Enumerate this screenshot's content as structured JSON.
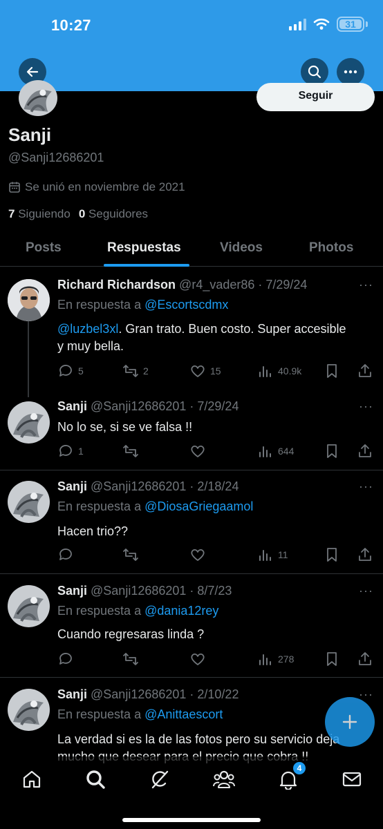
{
  "status_bar": {
    "time": "10:27",
    "battery": "31"
  },
  "profile": {
    "name": "Sanji",
    "handle": "@Sanji12686201",
    "joined": "Se unió en noviembre de 2021",
    "following_count": "7",
    "following_label": "Siguiendo",
    "followers_count": "0",
    "followers_label": "Seguidores",
    "follow_button": "Seguir"
  },
  "tabs": [
    {
      "label": "Posts",
      "active": false
    },
    {
      "label": "Respuestas",
      "active": true
    },
    {
      "label": "Videos",
      "active": false
    },
    {
      "label": "Photos",
      "active": false
    }
  ],
  "tweets": [
    {
      "name": "Richard Richardson",
      "meta": " @r4_vader86 · 7/29/24",
      "reply_prefix": "En respuesta a ",
      "reply_to": "@Escortscdmx",
      "mention": "@luzbel3xl",
      "text": ". Gran trato. Buen costo. Super accesible y muy bella.",
      "replies": "5",
      "retweets": "2",
      "likes": "15",
      "views": "40.9k"
    },
    {
      "name": "Sanji",
      "meta": " @Sanji12686201 · 7/29/24",
      "text": "No lo se, si se ve falsa !!",
      "replies": "1",
      "retweets": "",
      "likes": "",
      "views": "644"
    },
    {
      "name": "Sanji",
      "meta": " @Sanji12686201 · 2/18/24",
      "reply_prefix": "En respuesta a ",
      "reply_to": "@DiosaGriegaamol",
      "text": "Hacen trio??",
      "replies": "",
      "retweets": "",
      "likes": "",
      "views": "11"
    },
    {
      "name": "Sanji",
      "meta": " @Sanji12686201 · 8/7/23",
      "reply_prefix": "En respuesta a ",
      "reply_to": "@dania12rey",
      "text": "Cuando regresaras linda ?",
      "replies": "",
      "retweets": "",
      "likes": "",
      "views": "278"
    },
    {
      "name": "Sanji",
      "meta": " @Sanji12686201 · 2/10/22",
      "reply_prefix": "En respuesta a ",
      "reply_to": "@Anittaescort",
      "text": "La verdad si es la de las fotos pero su servicio deja mucho que desear para el precio que cobra !!"
    }
  ],
  "bottom_nav": {
    "notifications_badge": "4"
  },
  "icons": [
    "back-arrow-icon",
    "search-icon",
    "more-icon",
    "calendar-icon",
    "reply-icon",
    "retweet-icon",
    "like-icon",
    "views-icon",
    "bookmark-icon",
    "share-icon",
    "plus-icon",
    "home-icon",
    "grok-icon",
    "communities-icon",
    "bell-icon",
    "mail-icon"
  ],
  "colors": {
    "banner": "#2e9ae8",
    "accent": "#1d9bf0",
    "background": "#000000",
    "muted_text": "#71767b"
  }
}
